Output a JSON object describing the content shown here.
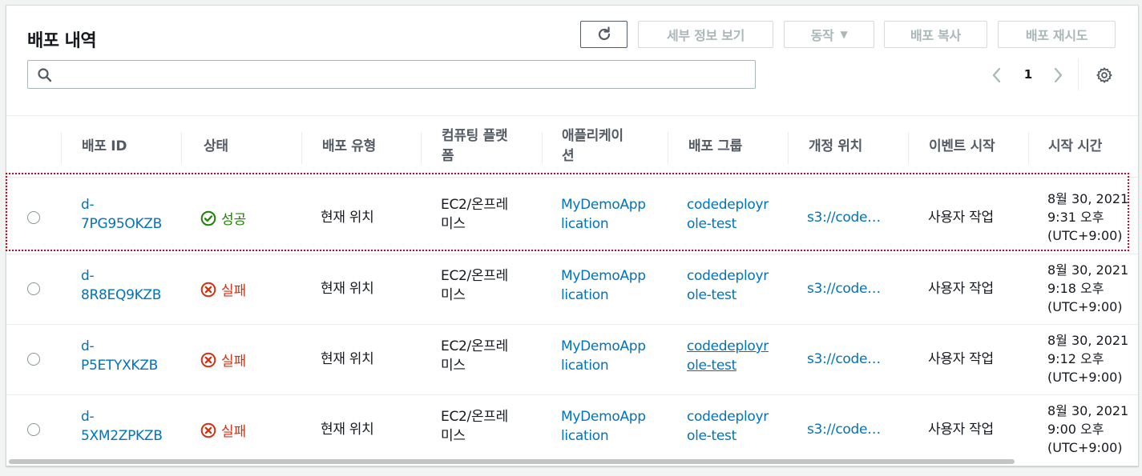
{
  "panel": {
    "title": "배포 내역",
    "buttons": {
      "details": "세부 정보 보기",
      "actions": "동작",
      "copy": "배포 복사",
      "retry": "배포 재시도"
    },
    "search": {
      "placeholder": "",
      "value": ""
    },
    "pagination": {
      "current_page": "1"
    }
  },
  "columns": [
    "배포 ID",
    "상태",
    "배포 유형",
    "컴퓨팅 플랫\n폼",
    "애플리케이\n션",
    "배포 그룹",
    "개정 위치",
    "이벤트 시작",
    "시작 시간"
  ],
  "rows": [
    {
      "id_line1": "d-",
      "id_line2": "7PG95OKZB",
      "status": "성공",
      "status_type": "success",
      "type": "현재 위치",
      "platform_line1": "EC2/온프레",
      "platform_line2": "미스",
      "app_line1": "MyDemoApp",
      "app_line2": "lication",
      "group_line1": "codedeployr",
      "group_line2": "ole-test",
      "revision": "s3://code…",
      "event": "사용자 작업",
      "time_line1": "8월 30, 2021",
      "time_line2": "9:31 오후",
      "time_line3": "(UTC+9:00)"
    },
    {
      "id_line1": "d-",
      "id_line2": "8R8EQ9KZB",
      "status": "실패",
      "status_type": "failed",
      "type": "현재 위치",
      "platform_line1": "EC2/온프레",
      "platform_line2": "미스",
      "app_line1": "MyDemoApp",
      "app_line2": "lication",
      "group_line1": "codedeployr",
      "group_line2": "ole-test",
      "revision": "s3://code…",
      "event": "사용자 작업",
      "time_line1": "8월 30, 2021",
      "time_line2": "9:18 오후",
      "time_line3": "(UTC+9:00)"
    },
    {
      "id_line1": "d-",
      "id_line2": "P5ETYXKZB",
      "status": "실패",
      "status_type": "failed",
      "type": "현재 위치",
      "platform_line1": "EC2/온프레",
      "platform_line2": "미스",
      "app_line1": "MyDemoApp",
      "app_line2": "lication",
      "group_line1": "codedeployr",
      "group_line2": "ole-test",
      "revision": "s3://code…",
      "event": "사용자 작업",
      "time_line1": "8월 30, 2021",
      "time_line2": "9:12 오후",
      "time_line3": "(UTC+9:00)"
    },
    {
      "id_line1": "d-",
      "id_line2": "5XM2ZPKZB",
      "status": "실패",
      "status_type": "failed",
      "type": "현재 위치",
      "platform_line1": "EC2/온프레",
      "platform_line2": "미스",
      "app_line1": "MyDemoApp",
      "app_line2": "lication",
      "group_line1": "codedeployr",
      "group_line2": "ole-test",
      "revision": "s3://code…",
      "event": "사용자 작업",
      "time_line1": "8월 30, 2021",
      "time_line2": "9:00 오후",
      "time_line3": "(UTC+9:00)"
    }
  ],
  "colors": {
    "link": "#0073bb",
    "success": "#1d8102",
    "failed": "#d13212",
    "highlight": "#d0021b"
  }
}
